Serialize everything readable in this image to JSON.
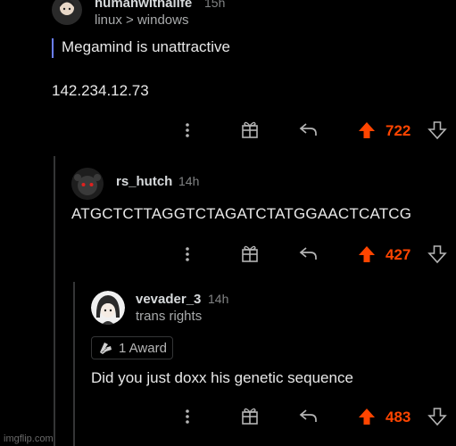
{
  "comments": [
    {
      "username": "humanwithalife",
      "time": "15h",
      "flair": "linux > windows",
      "quote": "Megamind is unattractive",
      "body": "142.234.12.73",
      "votes": "722"
    },
    {
      "username": "rs_hutch",
      "time": "14h",
      "body": "ATGCTCTTAGGTCTAGATCTATGGAACTCATCG",
      "votes": "427"
    },
    {
      "username": "vevader_3",
      "time": "14h",
      "flair": "trans rights",
      "award": "1 Award",
      "body": "Did you just doxx his genetic sequence",
      "votes": "483"
    }
  ],
  "watermark": "imgflip.com",
  "colors": {
    "background": "#000000",
    "upvote_active": "#ff4500",
    "quote_bar": "#6b7fff",
    "text": "#d7dadc"
  },
  "icons": [
    "more-vertical-icon",
    "gift-award-icon",
    "reply-icon",
    "upvote-arrow-icon",
    "downvote-arrow-icon"
  ]
}
